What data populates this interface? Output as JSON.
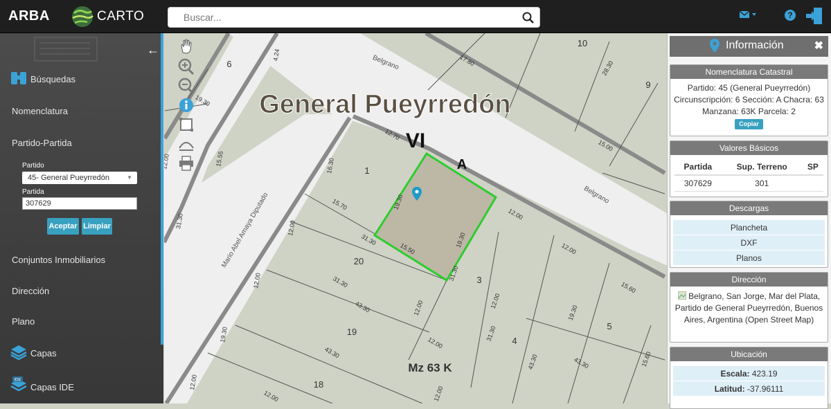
{
  "topbar": {
    "brand": "ARBA",
    "carto": "CARTO",
    "search_placeholder": "Buscar..."
  },
  "sidebar": {
    "busquedas": "Búsquedas",
    "nomenclatura": "Nomenclatura",
    "partido_partida": "Partido-Partida",
    "partido_label": "Partido",
    "partido_value": "45- General Pueyrredón",
    "partida_label": "Partida",
    "partida_value": "307629",
    "aceptar": "Aceptar",
    "limpiar": "Limpiar",
    "conjuntos": "Conjuntos Inmobiliarios",
    "direccion": "Dirección",
    "plano": "Plano",
    "capas": "Capas",
    "capas_ide": "Capas IDE",
    "ide_badge": "IDE"
  },
  "map": {
    "title": "General Pueyrredón",
    "circ": "VI",
    "section": "A",
    "manzana": "Mz 63 K",
    "streets": {
      "belgrano_top": "Belgrano",
      "belgrano_right": "Belgrano",
      "mario": "Mario Abel Amaya Diputado"
    },
    "parcels": [
      "6",
      "10",
      "9",
      "1",
      "20",
      "3",
      "19",
      "4",
      "5",
      "18"
    ],
    "dimensions": [
      "4.24",
      "17.80",
      "28.30",
      "19.30",
      "12.70",
      "16.30",
      "15.55",
      "15.00",
      "15.70",
      "19.30",
      "12.00",
      "31.30",
      "15.50",
      "19.30",
      "12.00",
      "12.00",
      "31.30",
      "12.00",
      "12.00",
      "15.60",
      "31.30",
      "43.30",
      "12.00",
      "31.30",
      "43.30",
      "12.00",
      "19.30",
      "12.00",
      "43.30",
      "43.30",
      "15.60",
      "19.30",
      "12.00",
      "31.30",
      "12.00",
      "12.00"
    ]
  },
  "info": {
    "title": "Información",
    "nomenclatura_title": "Nomenclatura Catastral",
    "nomenclatura_text": "Partido: 45 (General Pueyrredón) Circunscripción: 6 Sección: A Chacra: 63 Manzana: 63K Parcela: 2",
    "copiar": "Copiar",
    "valores_title": "Valores Básicos",
    "valores_headers": [
      "Partida",
      "Sup. Terreno",
      "SP"
    ],
    "valores_row": [
      "307629",
      "301",
      ""
    ],
    "descargas_title": "Descargas",
    "descargas": [
      "Plancheta",
      "DXF",
      "Planos"
    ],
    "direccion_title": "Dirección",
    "direccion_text": "Belgrano, San Jorge, Mar del Plata, Partido de General Pueyrredón, Buenos Aires, Argentina (Open Street Map)",
    "ubicacion_title": "Ubicación",
    "escala_label": "Escala:",
    "escala_value": "423.19",
    "latitud_label": "Latitud:",
    "latitud_value": "-37.96111"
  },
  "colors": {
    "accent": "#3ba2d8",
    "parcel_highlight": "#2ecc2e",
    "topbar": "#1f1f1f"
  }
}
